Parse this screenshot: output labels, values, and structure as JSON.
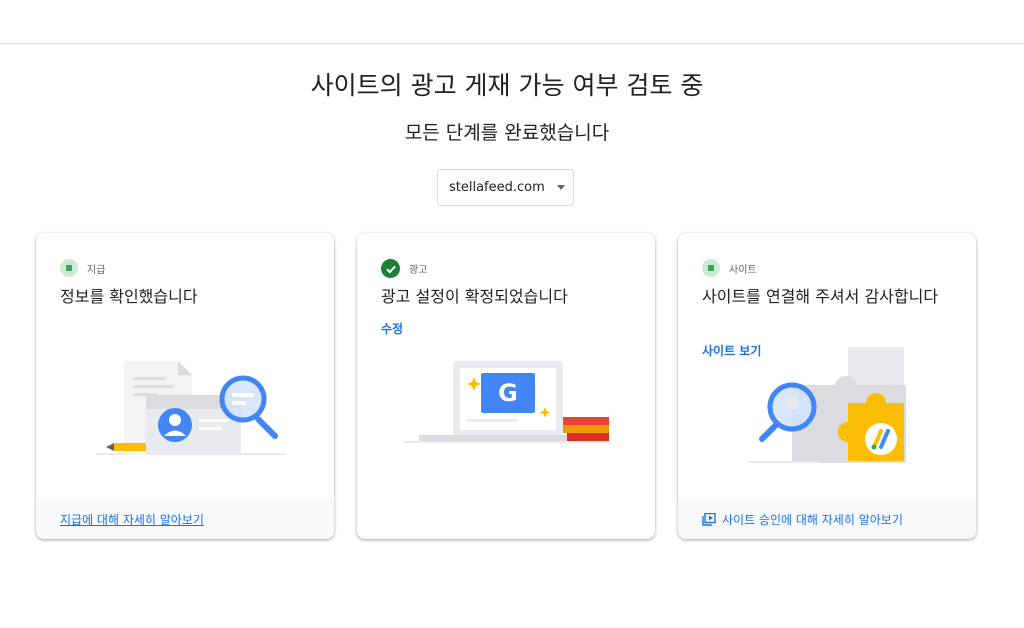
{
  "page": {
    "title": "사이트의 광고 게재 가능 여부 검토 중",
    "subtitle": "모든 단계를 완료했습니다",
    "site_selector": {
      "value": "stellafeed.com"
    }
  },
  "cards": [
    {
      "status_label": "지급",
      "status_icon": "square-icon",
      "title": "정보를 확인했습니다",
      "footer_link": "지급에 대해 자세히 알아보기"
    },
    {
      "status_label": "광고",
      "status_icon": "check-icon",
      "title": "광고 설정이 확정되었습니다",
      "action_link": "수정",
      "illustration_letter": "G"
    },
    {
      "status_label": "사이트",
      "status_icon": "square-icon",
      "title": "사이트를 연결해 주셔서 감사합니다",
      "action_link": "사이트 보기",
      "footer_link": "사이트 승인에 대해 자세히 알아보기"
    }
  ],
  "colors": {
    "link": "#1a73e8",
    "status_green": "#34a853",
    "status_bg": "#ceead6",
    "check_green": "#188038",
    "footer_bg": "#f8f9fa"
  }
}
